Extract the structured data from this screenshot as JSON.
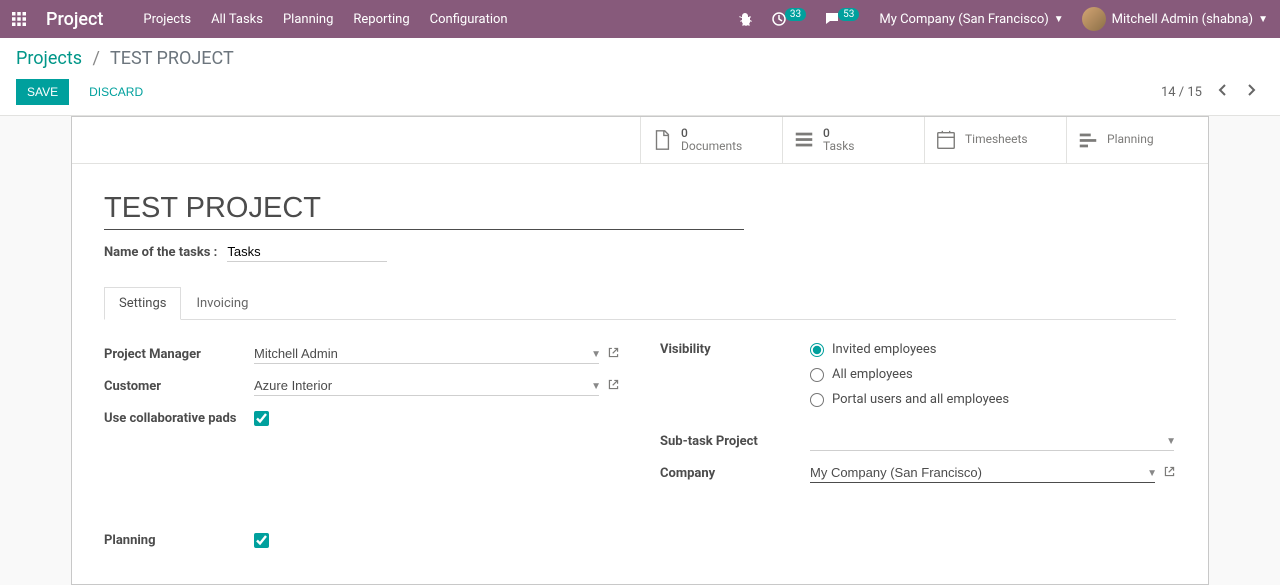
{
  "navbar": {
    "brand": "Project",
    "menu": [
      "Projects",
      "All Tasks",
      "Planning",
      "Reporting",
      "Configuration"
    ],
    "activities_badge": "33",
    "discuss_badge": "53",
    "company": "My Company (San Francisco)",
    "user": "Mitchell Admin (shabna)"
  },
  "breadcrumb": {
    "parent": "Projects",
    "current": "TEST PROJECT"
  },
  "buttons": {
    "save": "Save",
    "discard": "Discard"
  },
  "pager": {
    "text": "14 / 15"
  },
  "stat_buttons": {
    "documents": {
      "value": "0",
      "label": "Documents"
    },
    "tasks": {
      "value": "0",
      "label": "Tasks"
    },
    "timesheets": {
      "label": "Timesheets"
    },
    "planning": {
      "label": "Planning"
    }
  },
  "form": {
    "title": "TEST PROJECT",
    "task_name_label": "Name of the tasks :",
    "task_name_value": "Tasks"
  },
  "tabs": {
    "settings": "Settings",
    "invoicing": "Invoicing"
  },
  "settings": {
    "project_manager_label": "Project Manager",
    "project_manager": "Mitchell Admin",
    "customer_label": "Customer",
    "customer": "Azure Interior",
    "collaborative_label": "Use collaborative pads",
    "visibility_label": "Visibility",
    "visibility_options": {
      "invited": "Invited employees",
      "all": "All employees",
      "portal": "Portal users and all employees"
    },
    "subtask_label": "Sub-task Project",
    "subtask_value": "",
    "company_label": "Company",
    "company_value": "My Company (San Francisco)",
    "planning_label": "Planning"
  }
}
